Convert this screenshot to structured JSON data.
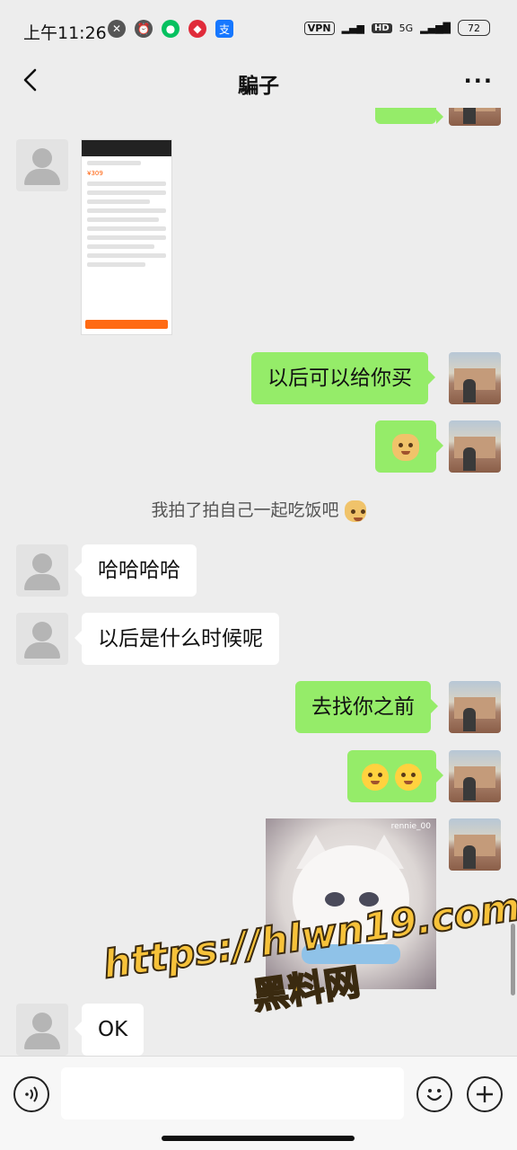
{
  "status_bar": {
    "time": "上午11:26",
    "vpn": "VPN",
    "hd": "HD",
    "network": "5G",
    "battery": "72"
  },
  "header": {
    "title": "騙子",
    "more": "···"
  },
  "messages": {
    "m1": "以后可以给你买",
    "system": "我拍了拍自己一起吃饭吧",
    "m2": "哈哈哈哈",
    "m3": "以后是什么时候呢",
    "m4": "去找你之前",
    "m5": "OK",
    "cat_tag": "rennie_00"
  },
  "thumbnail": {
    "price": "¥309"
  },
  "overlay": {
    "url": "https://hlwn19.com",
    "cn": "黑料网"
  },
  "icons": {
    "back": "chevron-left-icon",
    "more": "more-dots-icon",
    "voice": "voice-icon",
    "emoji": "emoji-icon",
    "plus": "plus-icon"
  }
}
